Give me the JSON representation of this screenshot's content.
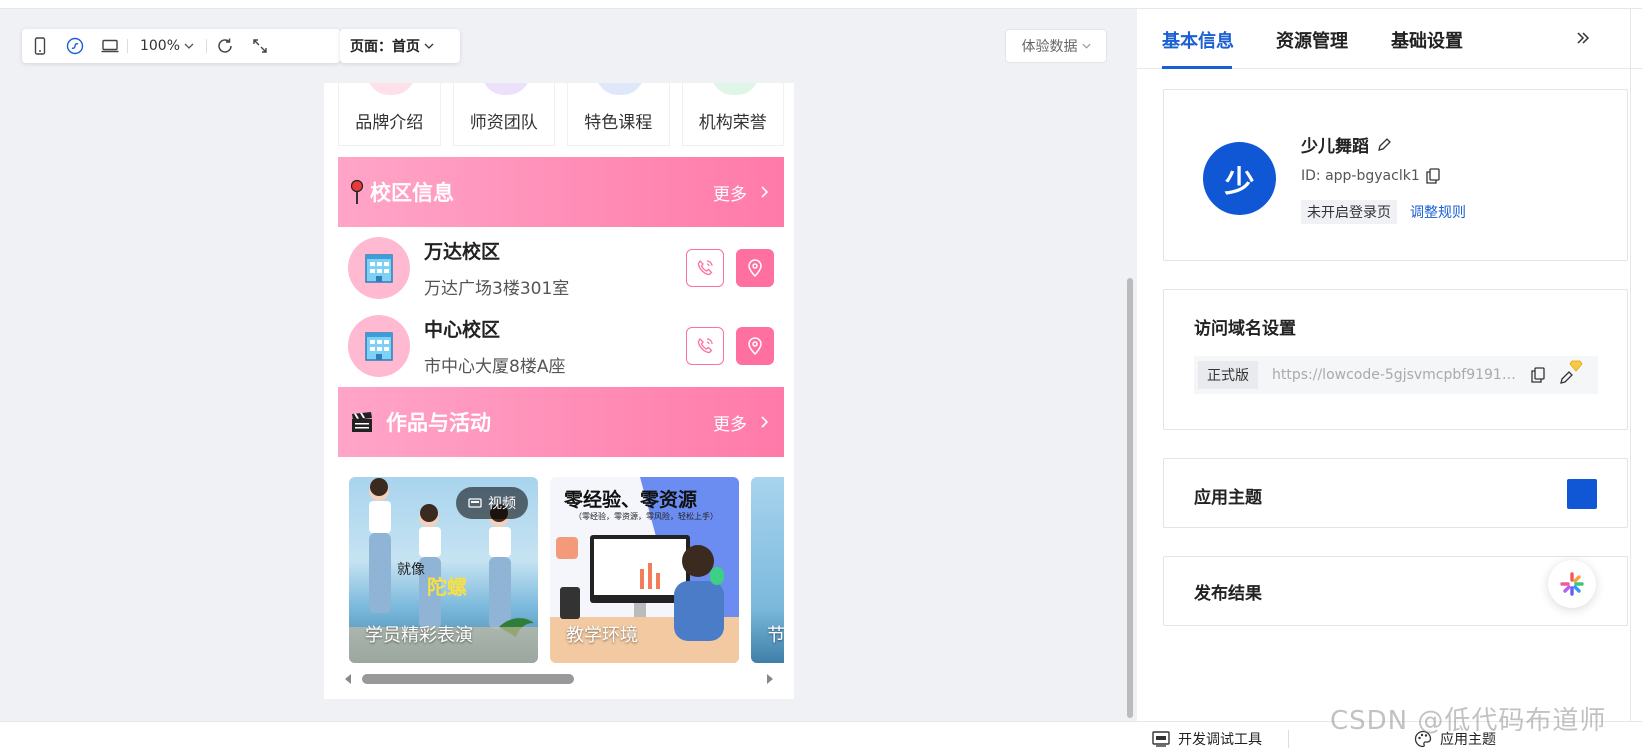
{
  "toolbar": {
    "zoom": "100%",
    "page_label": "页面：首页",
    "experience_data": "体验数据"
  },
  "nav_cards": [
    "品牌介绍",
    "师资团队",
    "特色课程",
    "机构荣誉"
  ],
  "campus_section": {
    "title": "校区信息",
    "more": "更多",
    "campuses": [
      {
        "name": "万达校区",
        "address": "万达广场3楼301室"
      },
      {
        "name": "中心校区",
        "address": "市中心大厦8楼A座"
      }
    ]
  },
  "works_section": {
    "title": "作品与活动",
    "more": "更多",
    "items": [
      {
        "label": "学员精彩表演",
        "badge": "视频",
        "caption": "就像",
        "caption2": "陀螺"
      },
      {
        "label": "教学环境",
        "headline": "零经验、零资源",
        "subline": "（零经验，零资源，零风险，轻松上手）"
      },
      {
        "label": "节"
      }
    ]
  },
  "panel": {
    "tabs": [
      "基本信息",
      "资源管理",
      "基础设置"
    ],
    "app": {
      "logo_char": "少",
      "name": "少儿舞蹈",
      "id": "ID: app-bgyaclk1",
      "login_status": "未开启登录页",
      "adjust_link": "调整规则"
    },
    "domain": {
      "title": "访问域名设置",
      "tag": "正式版",
      "url": "https://lowcode-5gjsvmcpbf91914b..."
    },
    "theme": {
      "title": "应用主题",
      "color": "#1057d6"
    },
    "publish": {
      "title": "发布结果"
    }
  },
  "statusbar": {
    "dev_tools": "开发调试工具",
    "apply_theme": "应用主题"
  },
  "watermark": "CSDN @低代码布道师",
  "colors": {
    "accent": "#1b5fd4",
    "pink": "#ff6f9f",
    "brand_blue": "#1057d6"
  }
}
